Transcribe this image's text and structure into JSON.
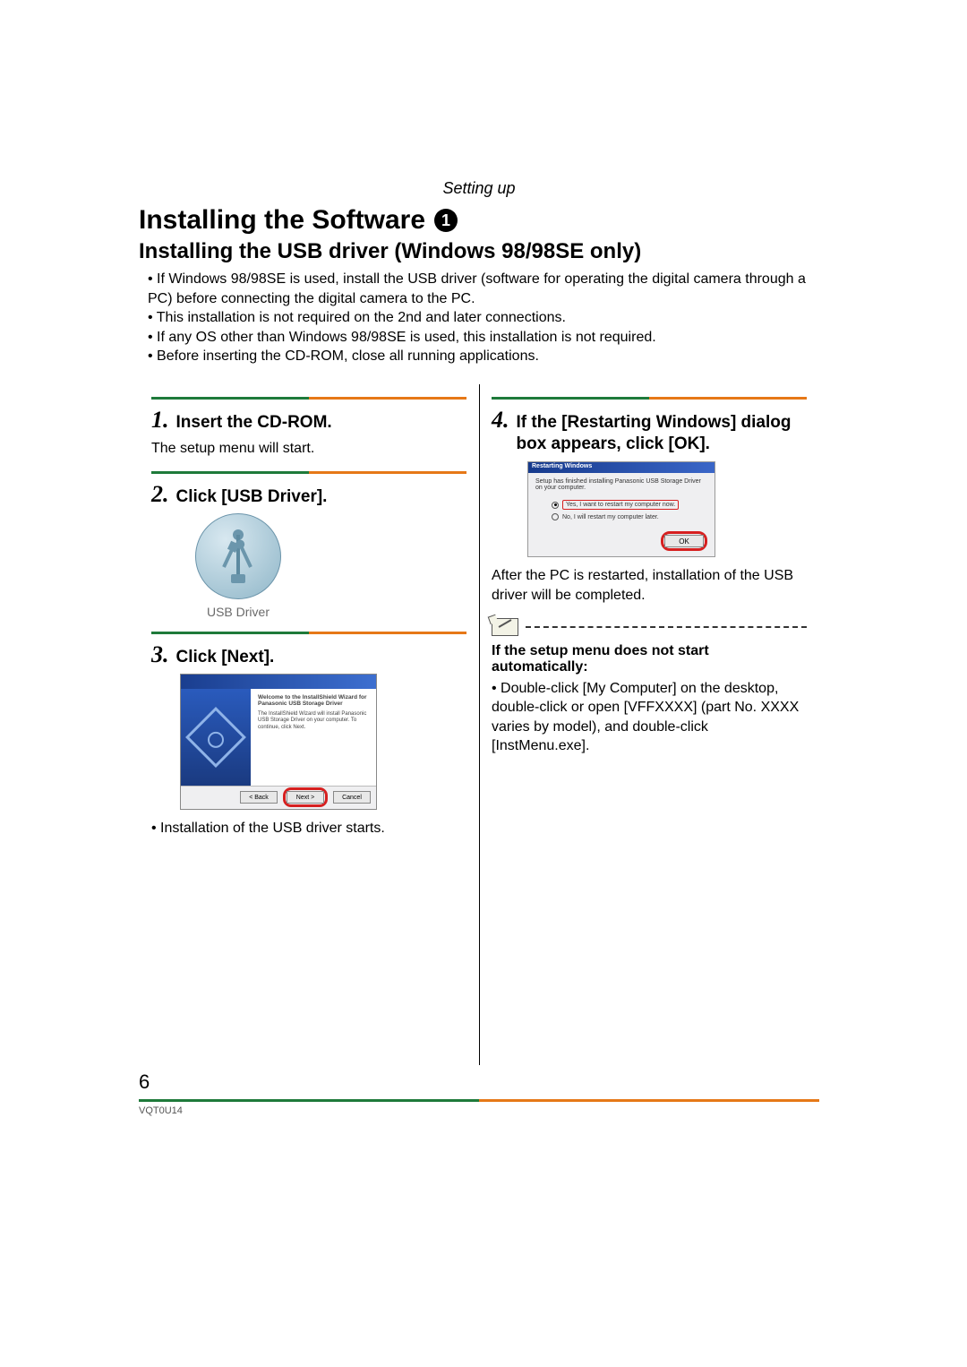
{
  "section_label": "Setting up",
  "title": "Installing the Software",
  "title_badge": "1",
  "subtitle": "Installing the USB driver (Windows 98/98SE only)",
  "intro": [
    "If Windows 98/98SE is used, install the USB driver (software for operating the digital camera through a PC) before connecting the digital camera to the PC.",
    "This installation is not required on the 2nd and later connections.",
    "If any OS other than Windows 98/98SE is used, this installation is not required.",
    "Before inserting the CD-ROM, close all running applications."
  ],
  "left": {
    "step1": {
      "num": "1.",
      "title": "Insert the CD-ROM.",
      "body": "The setup menu will start."
    },
    "step2": {
      "num": "2.",
      "title": "Click [USB Driver].",
      "icon_label": "USB Driver"
    },
    "step3": {
      "num": "3.",
      "title": "Click [Next].",
      "wizard_title": "Welcome to the InstallShield Wizard for Panasonic USB Storage Driver",
      "wizard_text": "The InstallShield Wizard will install Panasonic USB Storage Driver on your computer. To continue, click Next.",
      "btn_back": "< Back",
      "btn_next": "Next >",
      "btn_cancel": "Cancel",
      "note": "Installation of the USB driver starts."
    }
  },
  "right": {
    "step4": {
      "num": "4.",
      "title": "If the [Restarting Windows] dialog box appears, click [OK].",
      "dlg_title": "Restarting Windows",
      "dlg_msg": "Setup has finished installing Panasonic USB Storage Driver on your computer.",
      "opt1": "Yes, I want to restart my computer now.",
      "opt2": "No, I will restart my computer later.",
      "btn_ok": "OK",
      "after": "After the PC is restarted, installation of the USB driver will be completed."
    },
    "note_title": "If the setup menu does not start automatically:",
    "note_body": "Double-click [My Computer] on the desktop, double-click or open [VFFXXXX] (part No. XXXX varies by model), and double-click [InstMenu.exe]."
  },
  "page_number": "6",
  "doc_code": "VQT0U14"
}
